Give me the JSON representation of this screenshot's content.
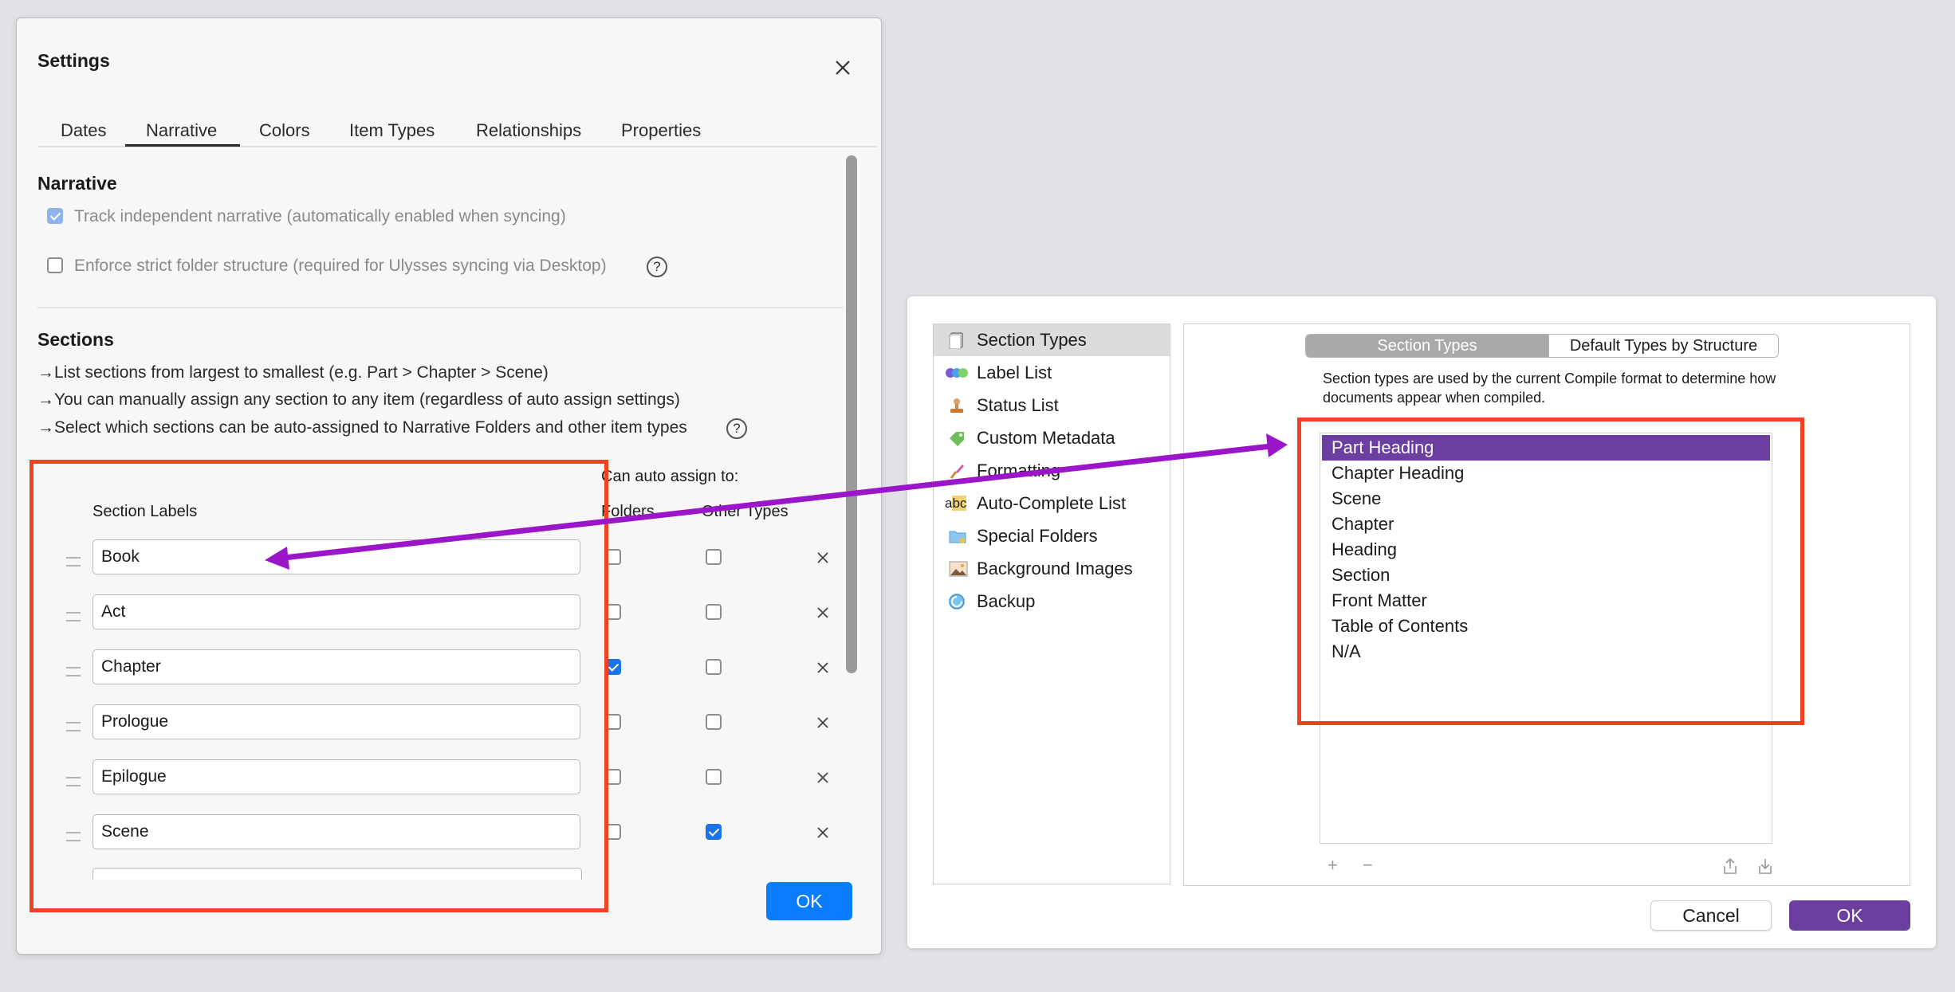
{
  "settings": {
    "title": "Settings",
    "tabs": [
      "Dates",
      "Narrative",
      "Colors",
      "Item Types",
      "Relationships",
      "Properties"
    ],
    "narrative": {
      "heading": "Narrative",
      "track_label": "Track independent narrative (automatically enabled when syncing)",
      "enforce_label": "Enforce strict folder structure (required for Ulysses syncing via Desktop)"
    },
    "sections": {
      "heading": "Sections",
      "notes": [
        "List sections from largest to smallest (e.g. Part > Chapter > Scene)",
        "You can manually assign any section to any item (regardless of auto assign settings)",
        "Select which sections can be auto-assigned to Narrative Folders and other item types"
      ],
      "can_auto_assign": "Can auto assign to:",
      "col_labels": "Section Labels",
      "col_folders": "Folders",
      "col_other": "Other Types",
      "rows": [
        {
          "label": "Book",
          "folders": false,
          "other": false
        },
        {
          "label": "Act",
          "folders": false,
          "other": false
        },
        {
          "label": "Chapter",
          "folders": true,
          "other": false
        },
        {
          "label": "Prologue",
          "folders": false,
          "other": false
        },
        {
          "label": "Epilogue",
          "folders": false,
          "other": false
        },
        {
          "label": "Scene",
          "folders": false,
          "other": true
        }
      ]
    },
    "ok_label": "OK"
  },
  "compile": {
    "sidebar": [
      {
        "label": "Section Types",
        "icon": "document-icon",
        "selected": true
      },
      {
        "label": "Label List",
        "icon": "color-circles-icon"
      },
      {
        "label": "Status List",
        "icon": "stamp-icon"
      },
      {
        "label": "Custom Metadata",
        "icon": "tag-icon"
      },
      {
        "label": "Formatting",
        "icon": "brush-icon"
      },
      {
        "label": "Auto-Complete List",
        "icon": "abc-icon"
      },
      {
        "label": "Special Folders",
        "icon": "folder-star-icon"
      },
      {
        "label": "Background Images",
        "icon": "image-icon"
      },
      {
        "label": "Backup",
        "icon": "backup-icon"
      }
    ],
    "segment": [
      "Section Types",
      "Default Types by Structure"
    ],
    "description": "Section types are used by the current Compile format to determine how documents appear when compiled.",
    "section_types": [
      "Part Heading",
      "Chapter Heading",
      "Scene",
      "Chapter",
      "Heading",
      "Section",
      "Front Matter",
      "Table of Contents",
      "N/A"
    ],
    "selected_type": "Part Heading",
    "cancel_label": "Cancel",
    "ok_label": "OK"
  },
  "colors": {
    "highlight_red": "#ef4223",
    "arrow_purple": "#9b16c8",
    "ok_blue": "#0a7cff",
    "selection_purple": "#6b3fa0"
  }
}
